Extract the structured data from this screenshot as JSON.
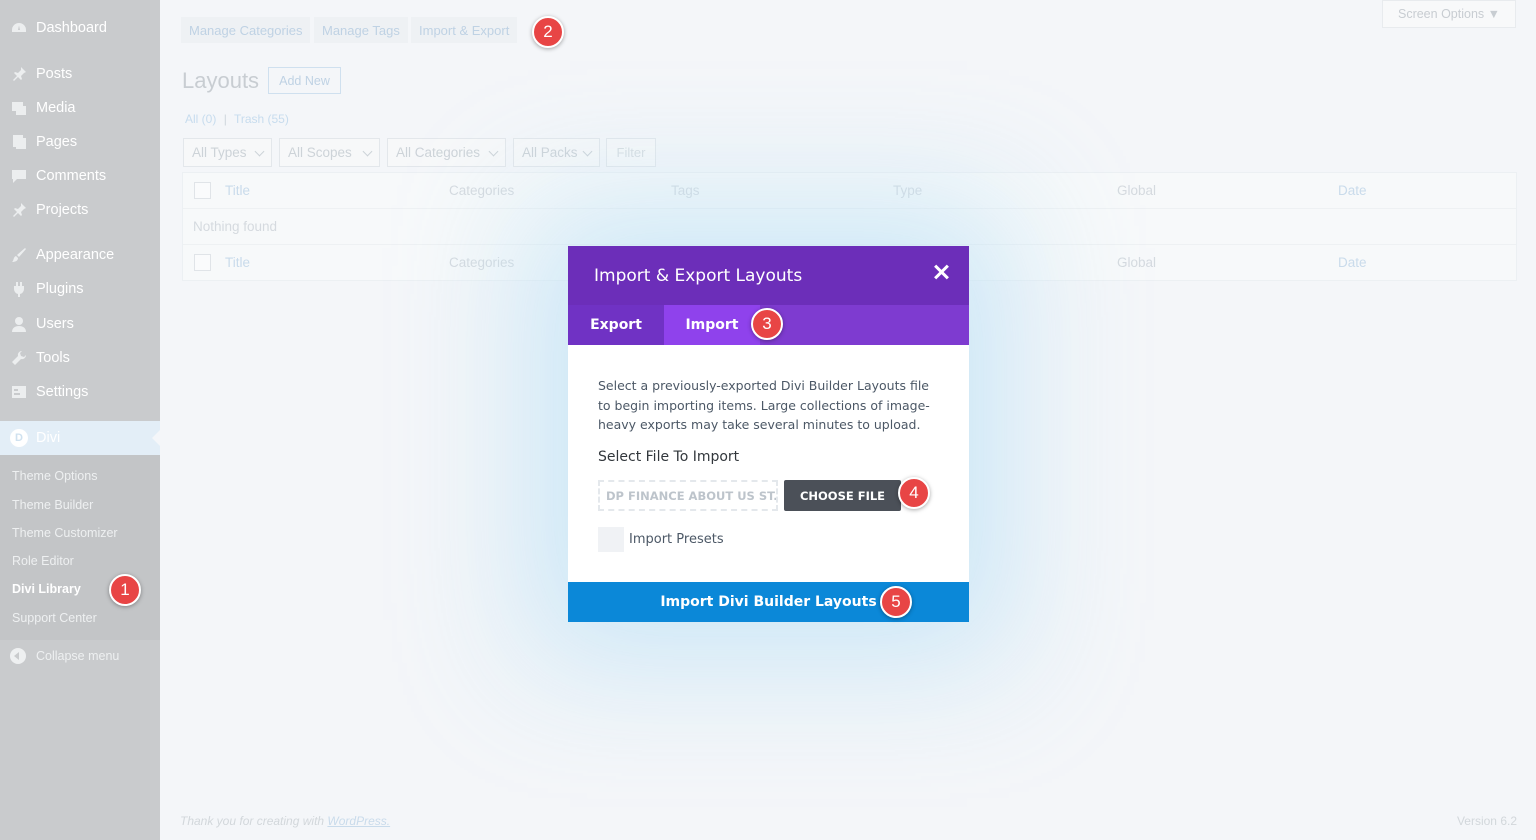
{
  "sidebar": {
    "items": [
      {
        "label": "Dashboard",
        "icon": "dashboard-icon"
      },
      {
        "label": "Posts",
        "icon": "pin-icon"
      },
      {
        "label": "Media",
        "icon": "media-icon"
      },
      {
        "label": "Pages",
        "icon": "pages-icon"
      },
      {
        "label": "Comments",
        "icon": "comment-icon"
      },
      {
        "label": "Projects",
        "icon": "pin-icon"
      },
      {
        "label": "Appearance",
        "icon": "brush-icon"
      },
      {
        "label": "Plugins",
        "icon": "plug-icon"
      },
      {
        "label": "Users",
        "icon": "user-icon"
      },
      {
        "label": "Tools",
        "icon": "wrench-icon"
      },
      {
        "label": "Settings",
        "icon": "settings-icon"
      }
    ],
    "divi": {
      "label": "Divi",
      "logo": "D"
    },
    "submenu": [
      "Theme Options",
      "Theme Builder",
      "Theme Customizer",
      "Role Editor",
      "Divi Library",
      "Support Center"
    ],
    "collapse": "Collapse menu"
  },
  "header": {
    "tabs": [
      "Manage Categories",
      "Manage Tags",
      "Import & Export"
    ],
    "screen_options": "Screen Options ▼"
  },
  "page": {
    "title": "Layouts",
    "add_new": "Add New",
    "all": "All (0)",
    "sep": "|",
    "trash": "Trash (55)",
    "filters": [
      "All Types",
      "All Scopes",
      "All Categories",
      "All Packs"
    ],
    "filter_button": "Filter",
    "columns": [
      "Title",
      "Categories",
      "Tags",
      "Type",
      "Global",
      "Date"
    ],
    "empty": "Nothing found"
  },
  "modal": {
    "title": "Import & Export Layouts",
    "tabs": [
      "Export",
      "Import"
    ],
    "active_tab": "Import",
    "description": "Select a previously-exported Divi Builder Layouts file to begin importing items. Large collections of image-heavy exports may take several minutes to upload.",
    "select_label": "Select File To Import",
    "file_value": "DP FINANCE ABOUT US ST...",
    "choose_button": "CHOOSE FILE",
    "checkbox_label": "Import Presets",
    "submit_button": "Import Divi Builder Layouts"
  },
  "footer": {
    "thanks": "Thank you for creating with",
    "wordpress": "WordPress.",
    "version": "Version 6.2"
  },
  "markers": [
    "1",
    "2",
    "3",
    "4",
    "5"
  ],
  "colors": {
    "modal_header": "#6c2eb9",
    "modal_tabs": "#7e3bd0",
    "submit": "#0b88d8",
    "marker": "#e84545"
  }
}
